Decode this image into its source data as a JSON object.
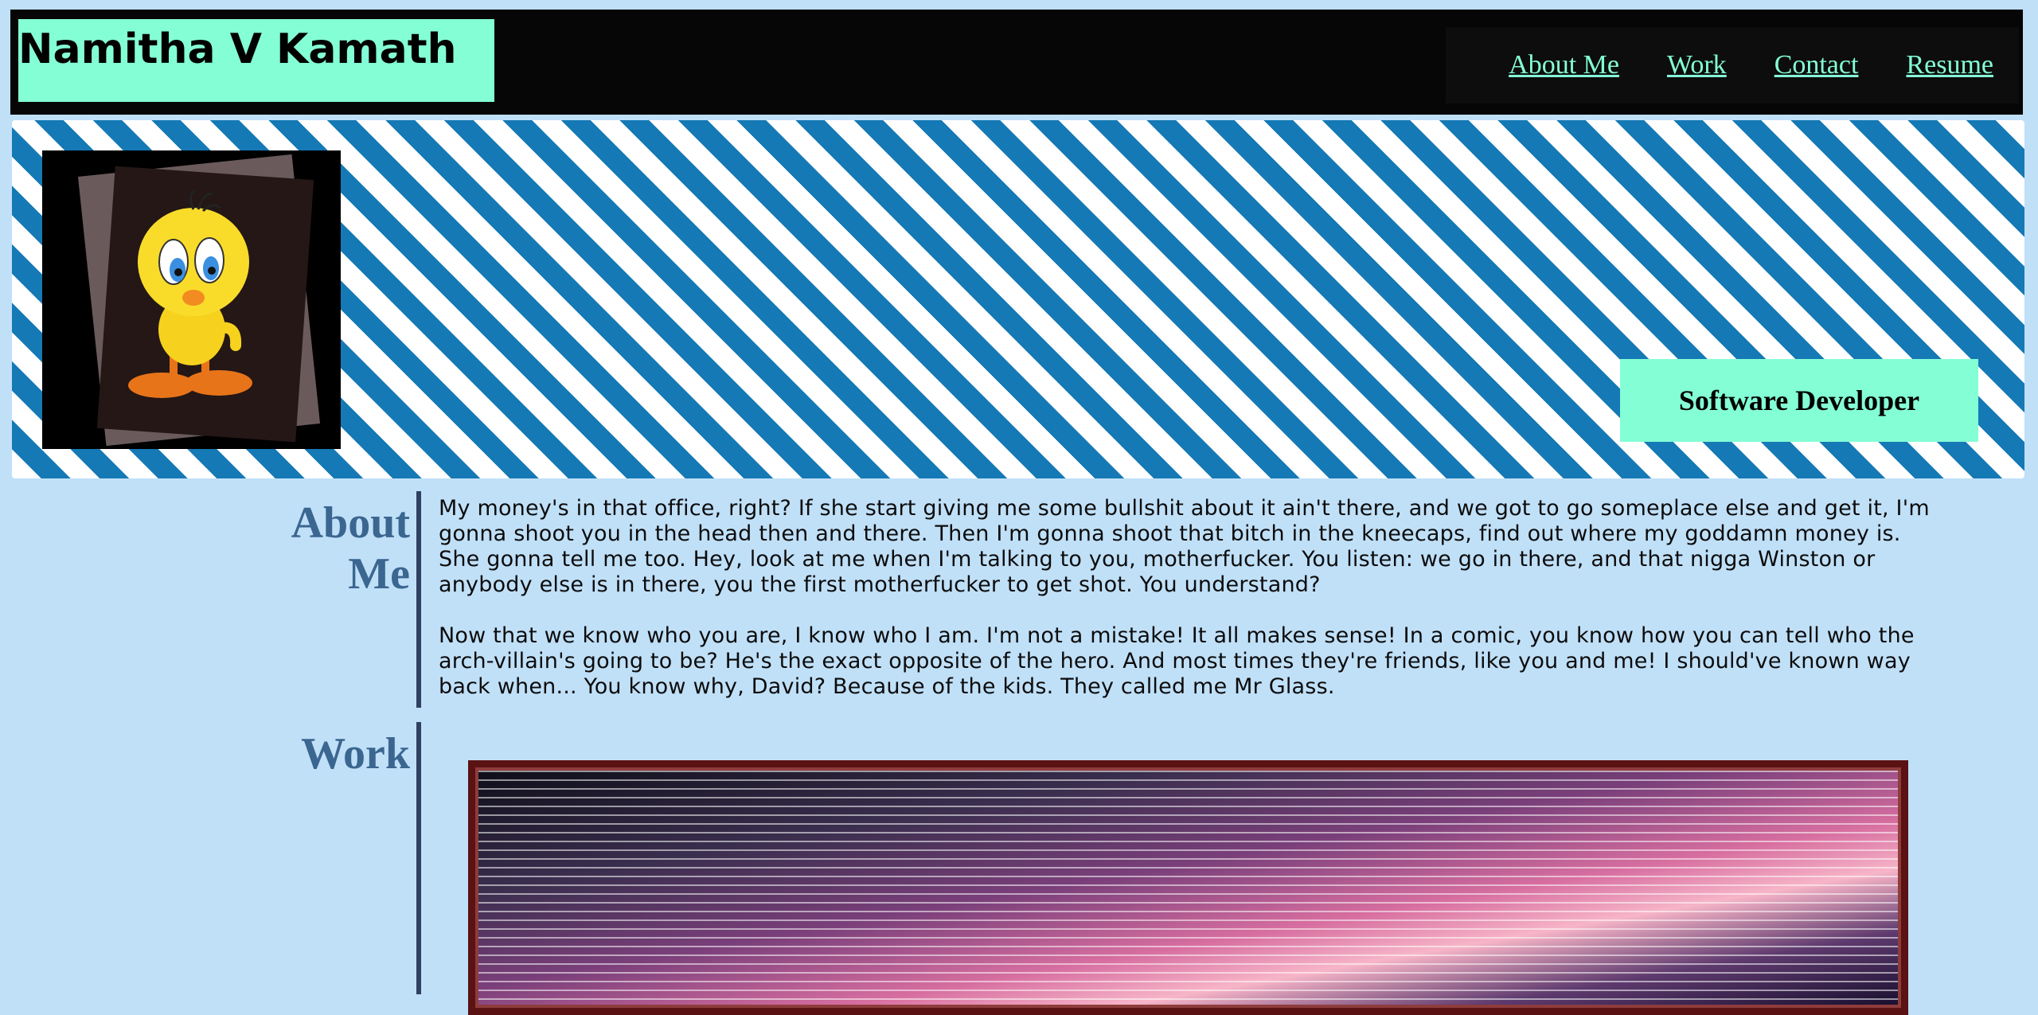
{
  "header": {
    "name": "Namitha V Kamath",
    "nav": [
      {
        "label": "About Me"
      },
      {
        "label": "Work"
      },
      {
        "label": "Contact"
      },
      {
        "label": "Resume"
      }
    ]
  },
  "banner": {
    "role": "Software Developer",
    "avatar_icon": "tweety-bird-icon"
  },
  "about": {
    "title": "About Me",
    "paragraphs": [
      "My money's in that office, right? If she start giving me some bullshit about it ain't there, and we got to go someplace else and get it, I'm gonna shoot you in the head then and there. Then I'm gonna shoot that bitch in the kneecaps, find out where my goddamn money is. She gonna tell me too. Hey, look at me when I'm talking to you, motherfucker. You listen: we go in there, and that nigga Winston or anybody else is in there, you the first motherfucker to get shot. You understand?",
      "Now that we know who you are, I know who I am. I'm not a mistake! It all makes sense! In a comic, you know how you can tell who the arch-villain's going to be? He's the exact opposite of the hero. And most times they're friends, like you and me! I should've known way back when... You know why, David? Because of the kids. They called me Mr Glass."
    ]
  },
  "work": {
    "title": "Work"
  },
  "colors": {
    "page_bg": "#c0e0f8",
    "accent": "#84ffd5",
    "stripe_blue": "#1579b5",
    "heading": "#3a6690"
  }
}
